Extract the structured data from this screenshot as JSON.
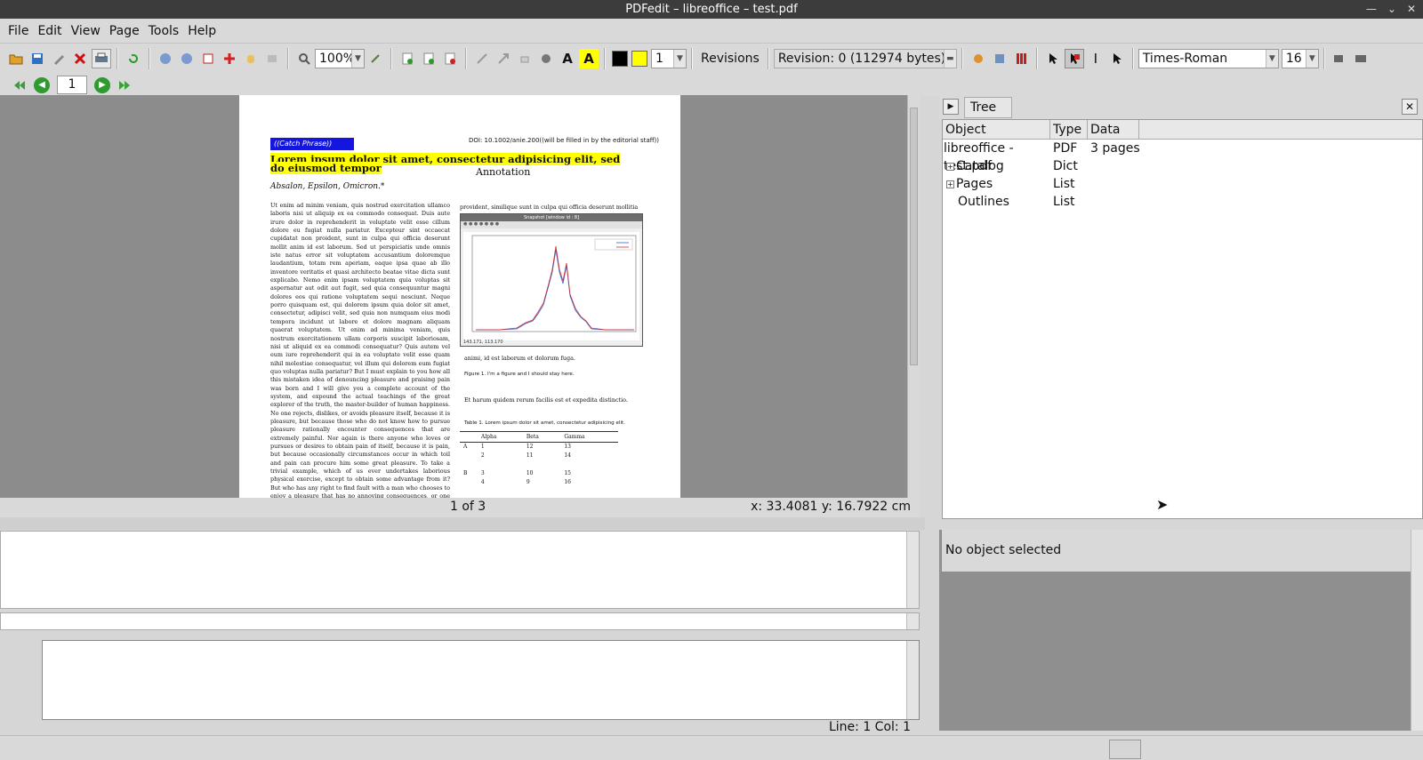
{
  "window": {
    "title": "PDFedit – libreoffice – test.pdf"
  },
  "menu": {
    "items": [
      "File",
      "Edit",
      "View",
      "Page",
      "Tools",
      "Help"
    ]
  },
  "toolbar": {
    "zoom": "100%",
    "line_width": "1",
    "revisions_label": "Revisions",
    "revision": "Revision: 0 (112974 bytes)",
    "font": "Times-Roman",
    "font_size": "16",
    "stroke_color": "#000000",
    "fill_color": "#ffff00"
  },
  "nav": {
    "page": "1"
  },
  "document": {
    "catch_phrase": "((Catch Phrase))",
    "doi": "DOI: 10.1002/anie.200((will be filled in by the editorial staff))",
    "title": "Lorem ipsum dolor sit amet, consectetur adipisicing elit, sed do eiusmod tempor",
    "annotation": "Annotation",
    "authors": "Absalon, Epsilon, Omicron.*",
    "left_column": "Ut enim ad minim veniam, quis nostrud exercitation ullamco laboris nisi ut aliquip ex ea commodo consequat. Duis aute irure dolor in reprehenderit in voluptate velit esse cillum dolore eu fugiat nulla pariatur. Excepteur sint occaecat cupidatat non proident, sunt in culpa qui officia deserunt mollit anim id est laborum. Sed ut perspiciatis unde omnis iste natus error sit voluptatem accusantium doloremque laudantium, totam rem aperiam, eaque ipsa quae ab illo inventore veritatis et quasi architecto beatae vitae dicta sunt explicabo. Nemo enim ipsam voluptatem quia voluptas sit aspernatur aut odit aut fugit, sed quia consequuntur magni dolores eos qui ratione voluptatem sequi nesciunt. Neque porro quisquam est, qui dolorem ipsum quia dolor sit amet, consectetur, adipisci velit, sed quia non numquam eius modi tempora incidunt ut labore et dolore magnam aliquam quaerat voluptatem. Ut enim ad minima veniam, quis nostrum exercitationem ullam corporis suscipit laboriosam, nisi ut aliquid ex ea commodi consequatur? Quis autem vel eum iure reprehenderit qui in ea voluptate velit esse quam nihil molestiae consequatur, vel illum qui dolorem eum fugiat quo voluptas nulla pariatur? But I must explain to you how all this mistaken idea of denouncing pleasure and praising pain was born and I will give you a complete account of the system, and expound the actual teachings of the great explorer of the truth, the master-builder of human happiness. No one rejects, dislikes, or avoids pleasure itself, because it is pleasure, but because those who do not know how to pursue pleasure rationally encounter consequences that are extremely painful. Nor again is there anyone who loves or pursues or desires to obtain pain of itself, because it is pain, but because occasionally circumstances occur in which toil and pain can procure him some great pleasure. To take a trivial example, which of us ever undertakes laborious physical exercise, except to obtain some advantage from it? But who has any right to find fault with a man who chooses to enjoy a pleasure that has no annoying consequences, or one who avoids a pain that produces no resultant pleasure?",
    "right_top": "provident, similique sunt in culpa qui officia deserunt mollitia",
    "snapshot_title": "Snapshot [window id : 8]",
    "snapshot_coords": "143.171, 113.170",
    "after_figure": "animi, id est laborum et dolorum fuga.",
    "figure_caption": "Figure 1. I'm a figure and I should stay here.",
    "et_harum": "Et harum quidem rerum facilis est et expedita distinctio.",
    "table_caption": "Table 1. Lorem ipsum dolor sit amet, consectetur adipisicing elit.",
    "table_headers": [
      "",
      "Alpha",
      "Beta",
      "Gamma"
    ],
    "table_rows": [
      [
        "A",
        "1",
        "12",
        "13"
      ],
      [
        "",
        "2",
        "11",
        "14"
      ],
      [
        "",
        "",
        "",
        ""
      ],
      [
        "B",
        "3",
        "10",
        "15"
      ],
      [
        "",
        "4",
        "9",
        "16"
      ]
    ]
  },
  "status": {
    "page_of": "1 of 3",
    "coords": "x: 33.4081 y: 16.7922 cm"
  },
  "editor": {
    "status": "Line: 1 Col: 1"
  },
  "tree": {
    "tab_label": "Tree",
    "columns": [
      "Object",
      "Type",
      "Data"
    ],
    "rows": [
      {
        "object": "libreoffice - test.pdf",
        "type": "PDF",
        "data": "3 pages"
      },
      {
        "object": "Catalog",
        "type": "Dict",
        "data": ""
      },
      {
        "object": "Pages",
        "type": "List",
        "data": ""
      },
      {
        "object": "Outlines",
        "type": "List",
        "data": ""
      }
    ]
  },
  "properties": {
    "empty_label": "No object selected"
  }
}
